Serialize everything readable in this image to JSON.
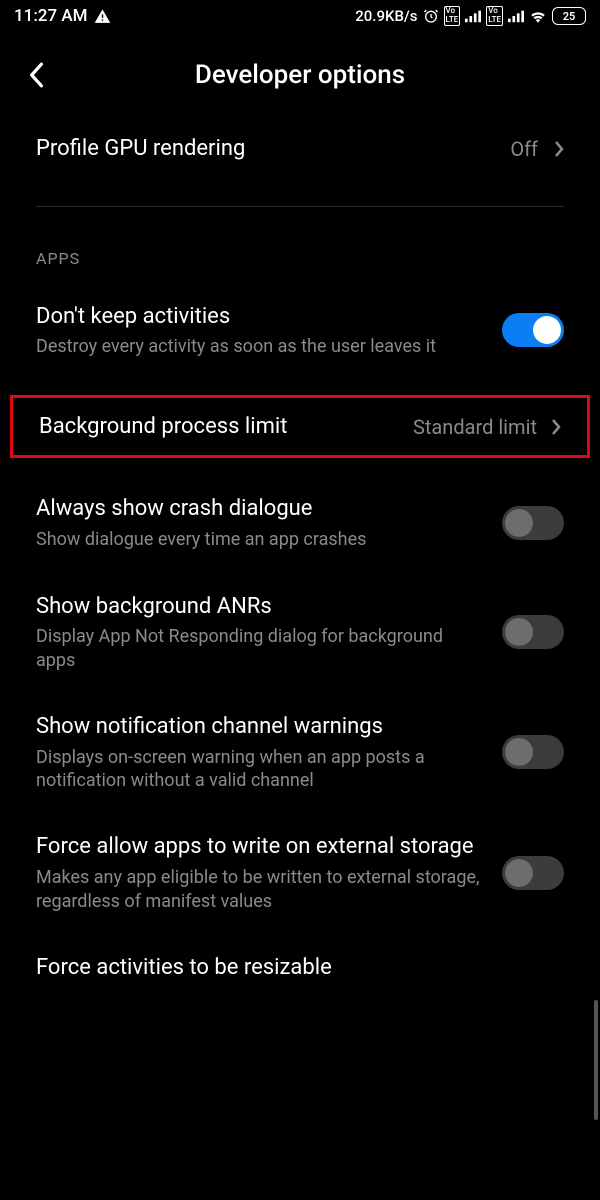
{
  "status": {
    "time": "11:27 AM",
    "net_speed": "20.9KB/s",
    "battery": "25"
  },
  "header": {
    "title": "Developer options"
  },
  "row_gpu": {
    "title": "Profile GPU rendering",
    "value": "Off"
  },
  "section_apps": "APPS",
  "row_keep": {
    "title": "Don't keep activities",
    "sub": "Destroy every activity as soon as the user leaves it"
  },
  "row_bg_limit": {
    "title": "Background process limit",
    "value": "Standard limit"
  },
  "row_crash": {
    "title": "Always show crash dialogue",
    "sub": "Show dialogue every time an app crashes"
  },
  "row_anr": {
    "title": "Show background ANRs",
    "sub": "Display App Not Responding dialog for background apps"
  },
  "row_notif": {
    "title": "Show notification channel warnings",
    "sub": "Displays on-screen warning when an app posts a notification without a valid channel"
  },
  "row_ext": {
    "title": "Force allow apps to write on external storage",
    "sub": "Makes any app eligible to be written to external storage, regardless of manifest values"
  },
  "row_resize": {
    "title": "Force activities to be resizable"
  }
}
